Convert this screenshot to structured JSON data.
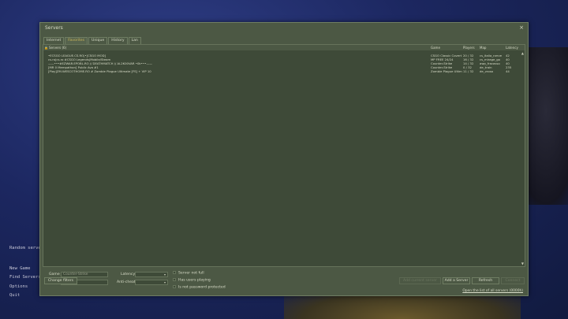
{
  "background_menu": {
    "items": [
      "Random serve",
      "New Game",
      "Find Servers",
      "Options",
      "Quit"
    ]
  },
  "window": {
    "title": "Servers",
    "close_symbol": "×"
  },
  "tabs": [
    {
      "label": "Internet",
      "active": false
    },
    {
      "label": "Favorites",
      "active": true
    },
    {
      "label": "Unique",
      "active": false
    },
    {
      "label": "History",
      "active": false
    },
    {
      "label": "Lan",
      "active": false
    }
  ],
  "list": {
    "headers": {
      "lock": "🔒",
      "name": "Servers (6)",
      "game": "Game",
      "players": "Players",
      "map": "Map",
      "latency": "Latency"
    },
    "rows": [
      {
        "name": "•ECSGO LEAGUE.CS.RO|•[CSGO MOD]",
        "game": "CSGO Classic Covert",
        "players": "20 / 32",
        "map": "cs_italia_nerve",
        "latency": "42"
      },
      {
        "name": "cs.ro|cs.ro #CSGO Legends|Mobile/Steam",
        "game": "MP FREE 24/24",
        "players": "16 / 32",
        "map": "cs_mirage_go",
        "latency": "40"
      },
      {
        "name": "——•••#EZWAR.EPOBL.RO // DEATHMATCH // AL2K00VAR •0k•••——",
        "game": "Counter-Strike",
        "players": "14 / 32",
        "map": "awp_fracasso",
        "latency": "40"
      },
      {
        "name": "[MR 0 Mempathon] Public Ava #1",
        "game": "Counter-Strike",
        "players": "0 / 32",
        "map": "de_train",
        "latency": "235"
      },
      {
        "name": "[Play]ZM.WESCOTHOME.RO # Zombie Plague Ultimate [FS] + VIP 10",
        "game": "Zombie Plague Ultim...",
        "players": "11 / 32",
        "map": "de_vrosa",
        "latency": "44"
      }
    ],
    "scroll_up_symbol": "▲",
    "scroll_down_symbol": "▼"
  },
  "filters": {
    "game_label": "Game",
    "game_value": "Counter-Strike",
    "map_label": "Map",
    "map_value": "",
    "latency_label": "Latency",
    "latency_value": "",
    "anticheat_label": "Anti-cheat",
    "anticheat_value": "",
    "select_arrow": "▾",
    "checks": [
      "Server not full",
      "Has users playing",
      "Is not password protected"
    ]
  },
  "buttons": {
    "change_filters": "Change filters",
    "connect": "Add current server",
    "add_server": "Add a Server",
    "refresh": "Refresh",
    "connect_btn": "Connect"
  },
  "link": "Open the list of all servers (0000h)"
}
